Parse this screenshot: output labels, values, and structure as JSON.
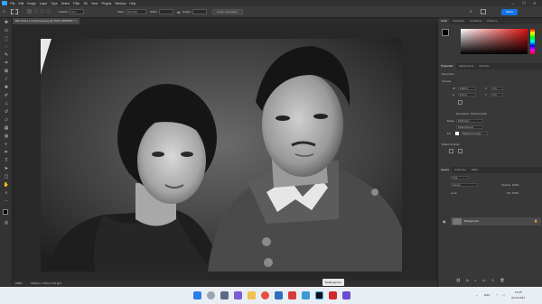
{
  "menubar": {
    "items": [
      "File",
      "Edit",
      "Image",
      "Layer",
      "Type",
      "Select",
      "Filter",
      "3D",
      "View",
      "Plugins",
      "Window",
      "Help"
    ],
    "window_controls": [
      "—",
      "❐",
      "✕"
    ]
  },
  "options": {
    "feather_label": "Feather:",
    "feather_value": "0 px",
    "style_label": "Style:",
    "style_value": "Normal",
    "width_label": "Width:",
    "height_label": "Height:",
    "select_mask_label": "Select and Mask...",
    "share_label": "Share"
  },
  "document": {
    "tab_title": "Bild (Foto) 1 (1)(1)(copy).jpg @ 100% (RGB/8#) *"
  },
  "status": {
    "zoom": "100%",
    "dimensions": "1200 px x 672 px (72 ppi)",
    "tooltip": "Radiergummi"
  },
  "panels": {
    "color_tabs": [
      "Color",
      "Swatches",
      "Gradients",
      "Patterns"
    ],
    "properties_tabs": [
      "Properties",
      "Adjustments",
      "Libraries"
    ],
    "doc_label": "Document",
    "canvas_label": "Canvas",
    "w_label": "W",
    "w_value": "1200 px",
    "h_label": "H",
    "h_value": "672 px",
    "x_label": "X",
    "x_value": "0 px",
    "y_label": "Y",
    "y_value": "0 px",
    "resolution": "Resolution: 1000 pixels/in",
    "mode_label": "Mode",
    "mode_value": "RGB Color",
    "depth_value": "8 Bits/Channel",
    "fill_label": "Fill",
    "fill_value": "Background Color",
    "rulers_label": "Rulers & Grids",
    "layers_tabs": [
      "Layers",
      "Channels",
      "Paths"
    ],
    "layer_kind": "Kind",
    "blend_mode": "Normal",
    "opacity_label": "Opacity: 100%",
    "lock_label": "Lock:",
    "fill_pct": "Fill: 100%",
    "layer_name": "Background"
  },
  "taskbar": {
    "lang": "ENG",
    "time": "13:05",
    "date": "03.03.2023"
  },
  "colors": {
    "accent": "#31a8ff",
    "share": "#1473e6",
    "taskbar": "#e9eef4"
  }
}
